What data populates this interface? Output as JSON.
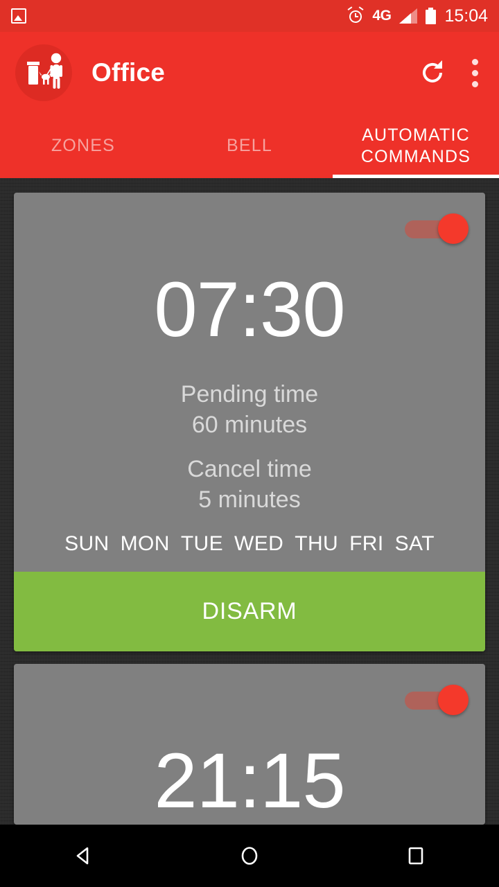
{
  "status_bar": {
    "photo_icon": "photo-icon",
    "alarm_icon": "alarm-icon",
    "network": "4G",
    "signal_icon": "signal-icon",
    "battery_icon": "battery-icon",
    "time": "15:04"
  },
  "app_bar": {
    "logo_icon": "dog-walker-logo-icon",
    "title": "Office",
    "refresh_icon": "refresh-icon",
    "overflow_icon": "overflow-menu-icon"
  },
  "tabs": [
    {
      "label": "ZONES",
      "active": false
    },
    {
      "label": "BELL",
      "active": false
    },
    {
      "label": "AUTOMATIC COMMANDS",
      "active": true
    }
  ],
  "cards": [
    {
      "time": "07:30",
      "toggle_on": true,
      "pending_label": "Pending time",
      "pending_value": "60 minutes",
      "cancel_label": "Cancel time",
      "cancel_value": "5 minutes",
      "days": [
        {
          "label": "SUN",
          "active": true
        },
        {
          "label": "MON",
          "active": true
        },
        {
          "label": "TUE",
          "active": true
        },
        {
          "label": "WED",
          "active": true
        },
        {
          "label": "THU",
          "active": true
        },
        {
          "label": "FRI",
          "active": true
        },
        {
          "label": "SAT",
          "active": true
        }
      ],
      "action_label": "DISARM"
    },
    {
      "time": "21:15",
      "toggle_on": true
    }
  ],
  "nav_bar": {
    "back": "back-icon",
    "home": "home-icon",
    "recents": "recents-icon"
  },
  "colors": {
    "primary": "#ee3129",
    "status_bar": "#e03127",
    "card": "#808080",
    "page_bg": "#2c2c2c",
    "toggle_on": "#f4392b",
    "disarm": "#82bb41"
  }
}
